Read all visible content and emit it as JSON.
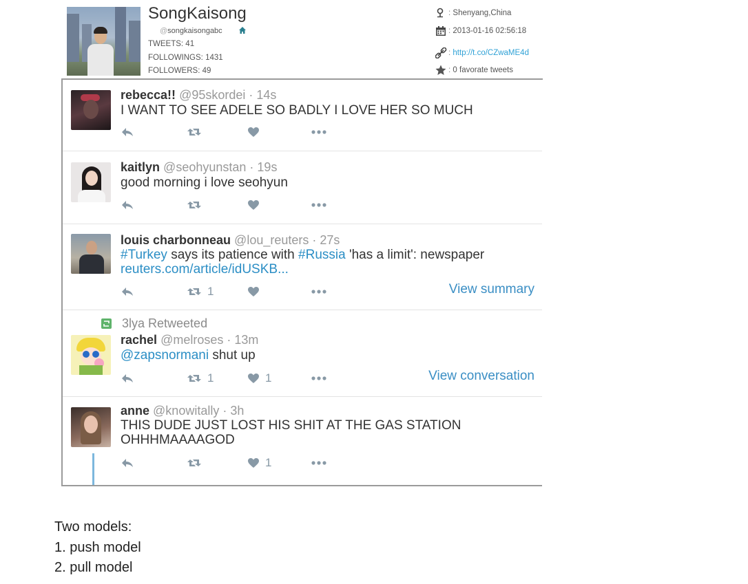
{
  "profile": {
    "name": "SongKaisong",
    "handle_at": "@",
    "handle": "songkaisongabc",
    "tweets": "TWEETS: 41",
    "followings": "FOLLOWINGS: 1431",
    "followers": "FOLLOWERS: 49",
    "location": "Shenyang,China",
    "joined": "2013-01-16 02:56:18",
    "link": "http://t.co/CZwaME4d",
    "favorites": "0 favorate tweets",
    "colon": ":"
  },
  "tweets": [
    {
      "name": "rebecca!!",
      "handle": "@95skordei",
      "time": "· 14s",
      "lines": [
        "I WANT TO SEE ADELE SO BADLY I LOVE HER SO MUCH"
      ]
    },
    {
      "name": "kaitlyn",
      "handle": "@seohyunstan",
      "time": "· 19s",
      "lines": [
        "good morning i love seohyun"
      ]
    },
    {
      "name": "louis charbonneau",
      "handle": "@lou_reuters",
      "time": "· 27s",
      "text_parts": [
        "#Turkey",
        " says its patience with ",
        "#Russia",
        " 'has a limit': newspaper"
      ],
      "link": "reuters.com/article/idUSKB...",
      "retweet_count": "1",
      "view_link": "View summary"
    },
    {
      "retweeted_by": "3lya Retweeted",
      "name": "rachel",
      "handle": "@melroses",
      "time": "· 13m",
      "mention": "@zapsnormani",
      "text_rest": " shut up",
      "retweet_count": "1",
      "like_count": "1",
      "view_link": "View conversation"
    },
    {
      "name": "anne",
      "handle": "@knowitally",
      "time": "· 3h",
      "lines": [
        "THIS DUDE JUST LOST HIS SHIT AT THE GAS STATION",
        "OHHHMAAAAGOD"
      ],
      "like_count": "1"
    }
  ],
  "notes": {
    "heading": "Two models:",
    "item1": "1. push model",
    "item2": "2. pull model"
  },
  "colors": {
    "link_blue": "#2b8ec5",
    "retweet_green": "#5fb36b",
    "icon_gray": "#8899a6"
  },
  "icons": [
    "location-pin-icon",
    "calendar-icon",
    "link-icon",
    "star-icon",
    "home-icon",
    "reply-icon",
    "retweet-icon",
    "heart-icon",
    "more-icon"
  ]
}
